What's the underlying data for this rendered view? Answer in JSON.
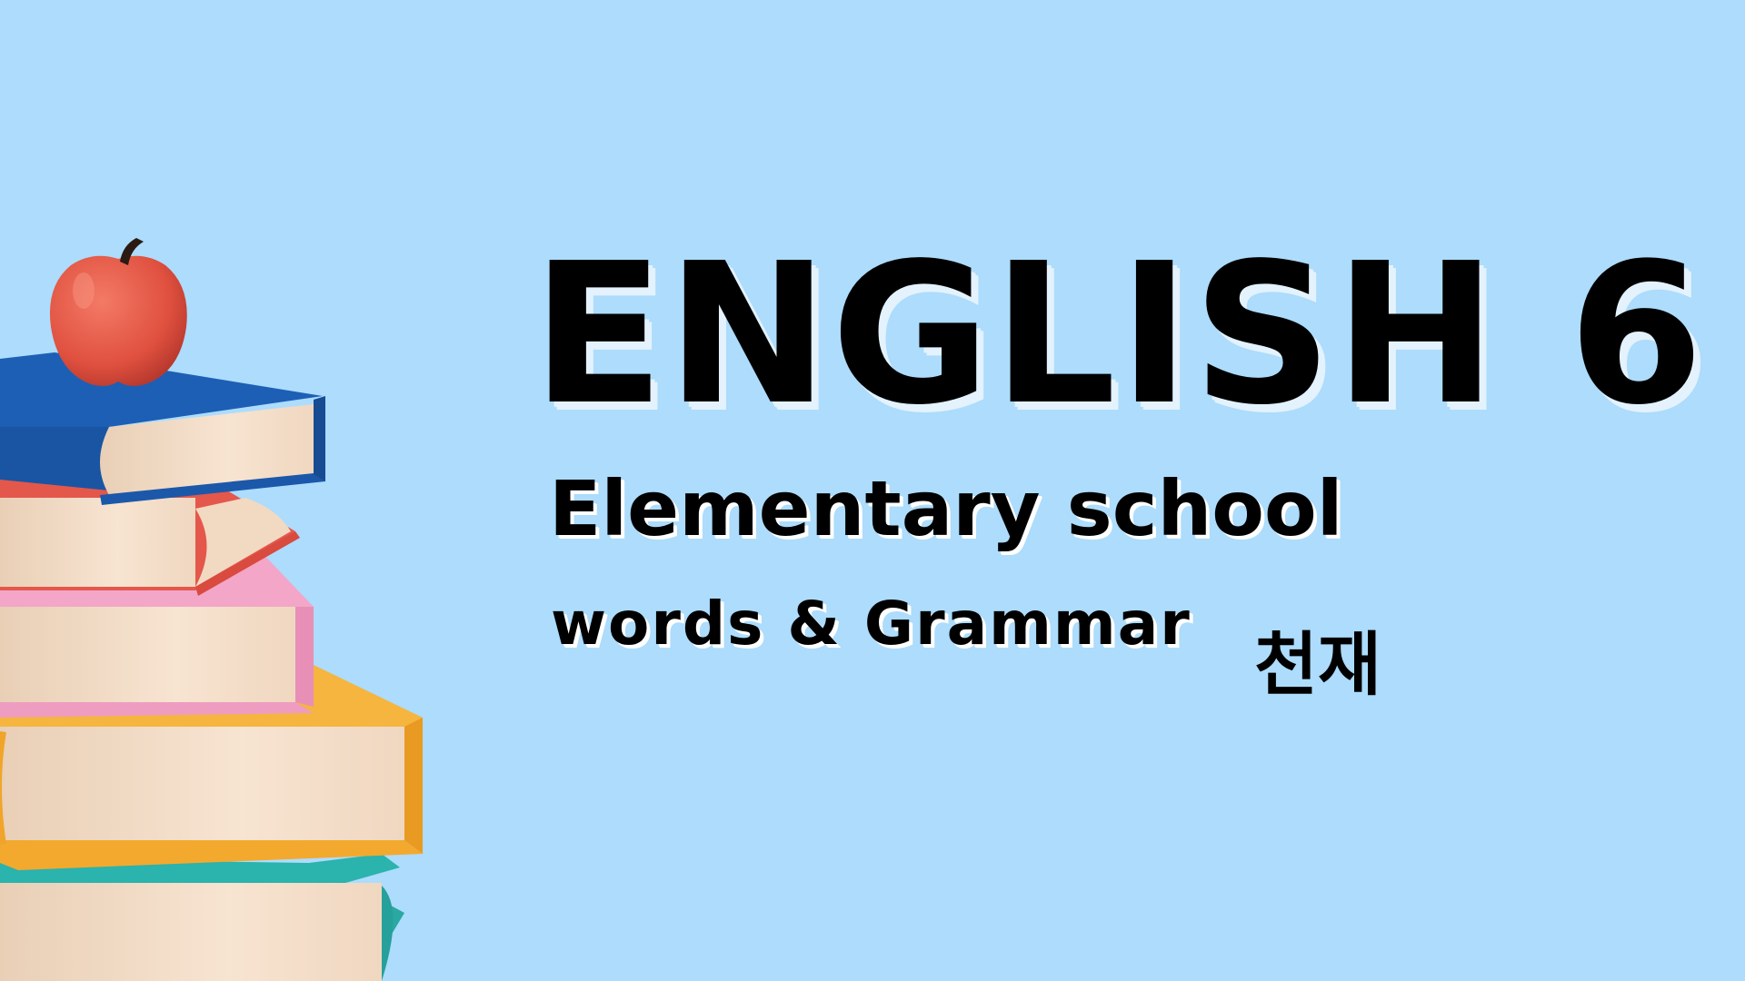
{
  "cover": {
    "title": "ENGLISH 6",
    "subtitle": "Elementary school",
    "tagline": "words & Grammar",
    "publisher": "천재"
  },
  "illustration": {
    "icon": "stacked-books-with-apple-icon"
  },
  "colors": {
    "background": "#addcfc",
    "text": "#000000",
    "title_shadow": "#e3f2fd",
    "book_blue": "#1d5fb5",
    "book_red": "#e4574b",
    "book_pink": "#f3a6c8",
    "book_yellow": "#f7b23b",
    "book_teal": "#2bb3ad",
    "pages": "#f3dcc6",
    "apple": "#e55546"
  }
}
